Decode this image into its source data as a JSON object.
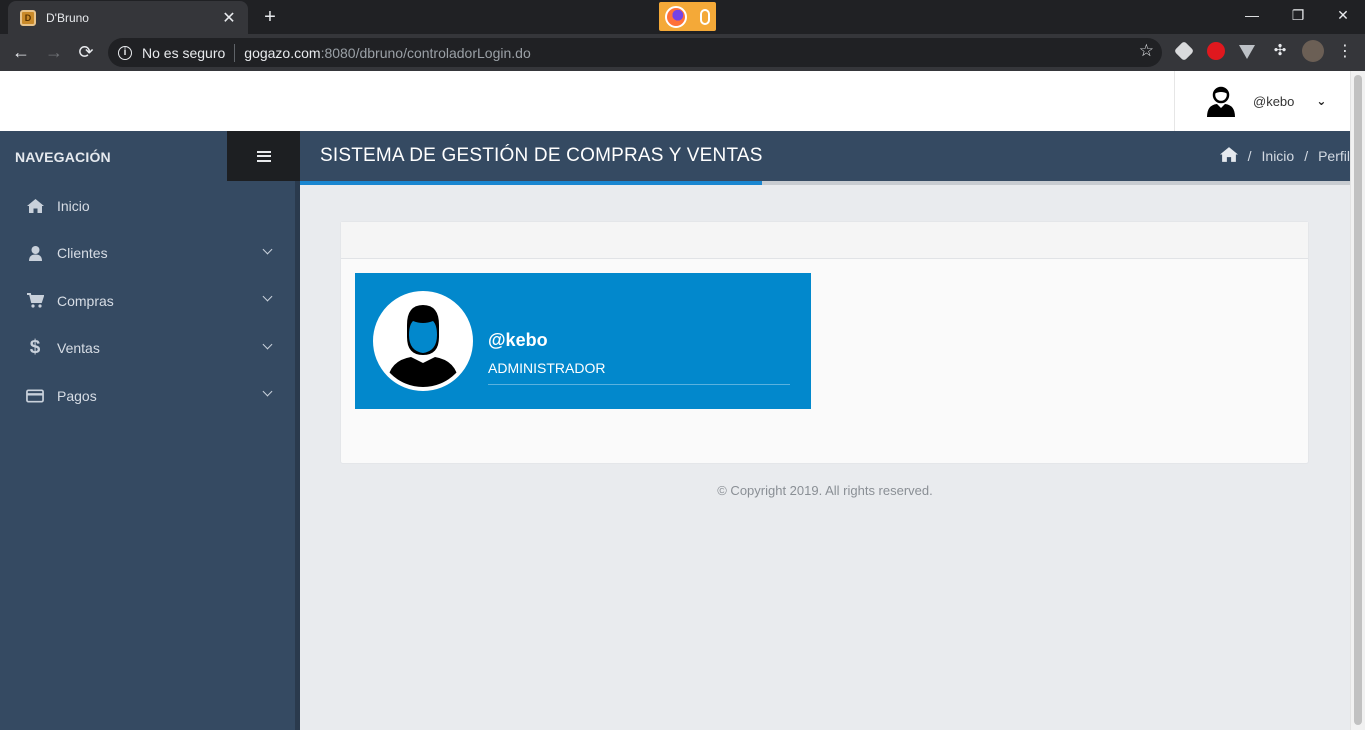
{
  "browser": {
    "tab_title": "D'Bruno",
    "tab_close": "✕",
    "new_tab": "+",
    "security_text": "No es seguro",
    "url_host": "gogazo.com",
    "url_rest": ":8080/dbruno/controladorLogin.do",
    "window_controls": [
      "—",
      "❐",
      "✕"
    ]
  },
  "header": {
    "username": "@kebo"
  },
  "sidebar": {
    "title": "NAVEGACIÓN",
    "items": [
      {
        "label": "Inicio",
        "icon": "home-icon",
        "expandable": false
      },
      {
        "label": "Clientes",
        "icon": "user-icon",
        "expandable": true
      },
      {
        "label": "Compras",
        "icon": "cart-icon",
        "expandable": true
      },
      {
        "label": "Ventas",
        "icon": "dollar-icon",
        "expandable": true
      },
      {
        "label": "Pagos",
        "icon": "credit-card-icon",
        "expandable": true
      }
    ]
  },
  "page": {
    "title": "SISTEMA DE GESTIÓN DE COMPRAS Y VENTAS",
    "breadcrumb": [
      "Inicio",
      "Perfil"
    ],
    "breadcrumb_sep": "/",
    "loading_progress": 0.44
  },
  "profile": {
    "name": "@kebo",
    "role": "ADMINISTRADOR",
    "accent_color": "#0288cc"
  },
  "footer": {
    "copyright": "© Copyright 2019. All rights reserved."
  },
  "colors": {
    "sidebar_bg": "#354a62",
    "page_bg": "#e9ebee",
    "accent": "#1a86d0"
  }
}
